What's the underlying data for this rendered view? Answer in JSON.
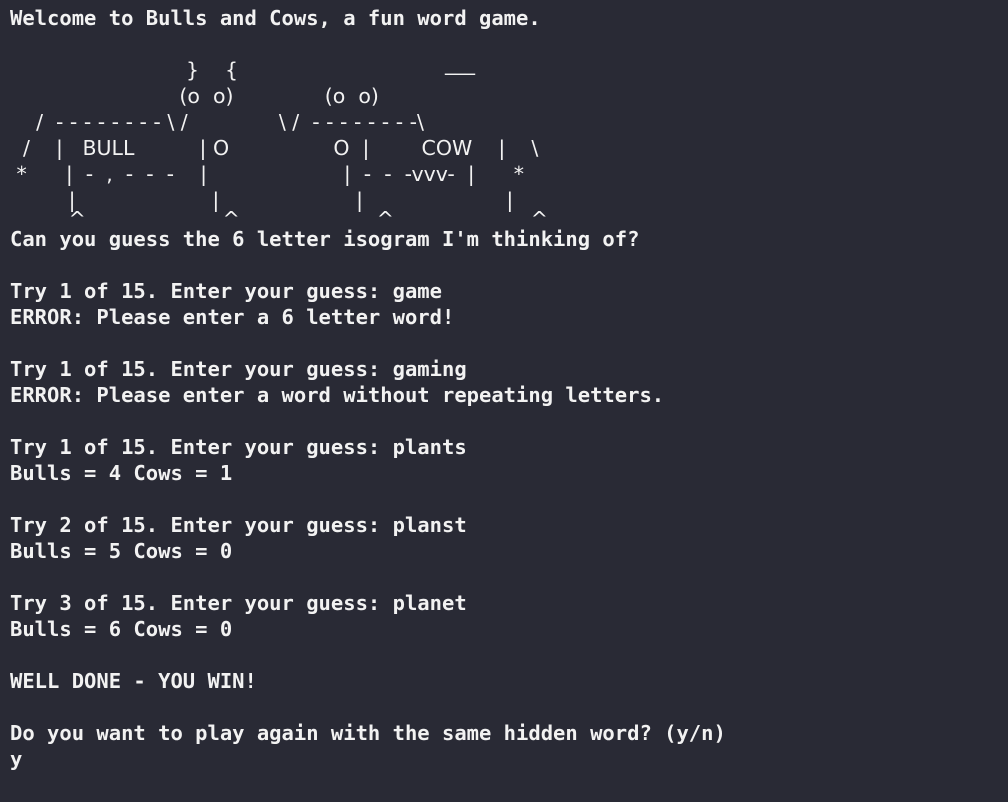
{
  "terminal": {
    "welcome": "Welcome to Bulls and Cows, a fun word game.",
    "blank1": "",
    "art": [
      "                           }    {",
      "                          (o  o)              (o  o)",
      "    /  - - - - - - - - \\ /              \\ /  - - - - - - - -\\",
      "  /    |   BULL          | O                O  |        COW    |    \\",
      " *      |  -  ,  -  -  -    |                     |  -  -  -vvv-  |      *",
      "         |                     |                     |                      |",
      "         ^                     ^                     ^                     ^"
    ],
    "cow_hat": "___",
    "question": "Can you guess the 6 letter isogram I'm thinking of?",
    "blank2": "",
    "try1_prompt": "Try 1 of 15. Enter your guess: game",
    "try1_error": "ERROR: Please enter a 6 letter word!",
    "blank3": "",
    "try1b_prompt": "Try 1 of 15. Enter your guess: gaming",
    "try1b_error": "ERROR: Please enter a word without repeating letters.",
    "blank4": "",
    "try1c_prompt": "Try 1 of 15. Enter your guess: plants",
    "try1c_result": "Bulls = 4 Cows = 1",
    "blank5": "",
    "try2_prompt": "Try 2 of 15. Enter your guess: planst",
    "try2_result": "Bulls = 5 Cows = 0",
    "blank6": "",
    "try3_prompt": "Try 3 of 15. Enter your guess: planet",
    "try3_result": "Bulls = 6 Cows = 0",
    "blank7": "",
    "win": "WELL DONE - YOU WIN!",
    "blank8": "",
    "play_again": "Do you want to play again with the same hidden word? (y/n)",
    "answer": "y"
  }
}
